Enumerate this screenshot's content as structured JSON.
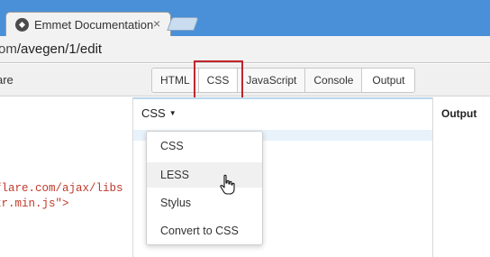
{
  "browser": {
    "active_tab": {
      "title": "Emmet Documentation",
      "favicon": "emmet-logo-icon",
      "close": "×"
    },
    "new_tab": "new-tab-button",
    "url": {
      "prefix": "om",
      "path": "/avegen/1/edit"
    }
  },
  "toolbar": {
    "left_label": "are",
    "tabs": [
      {
        "label": "HTML",
        "active": false
      },
      {
        "label": "CSS",
        "active": true
      },
      {
        "label": "JavaScript",
        "active": false
      },
      {
        "label": "Console",
        "active": false
      },
      {
        "label": "Output",
        "active": true
      }
    ],
    "highlight_color": "#c0262d"
  },
  "left_panel": {
    "code_lines": [
      "flare.com/ajax/libs",
      "zr.min.js\">"
    ]
  },
  "css_panel": {
    "preprocessor": "CSS",
    "caret": "▼",
    "dropdown_options": [
      "CSS",
      "LESS",
      "Stylus",
      "Convert to CSS"
    ],
    "hovered_option": "LESS"
  },
  "output_panel": {
    "title": "Output"
  }
}
